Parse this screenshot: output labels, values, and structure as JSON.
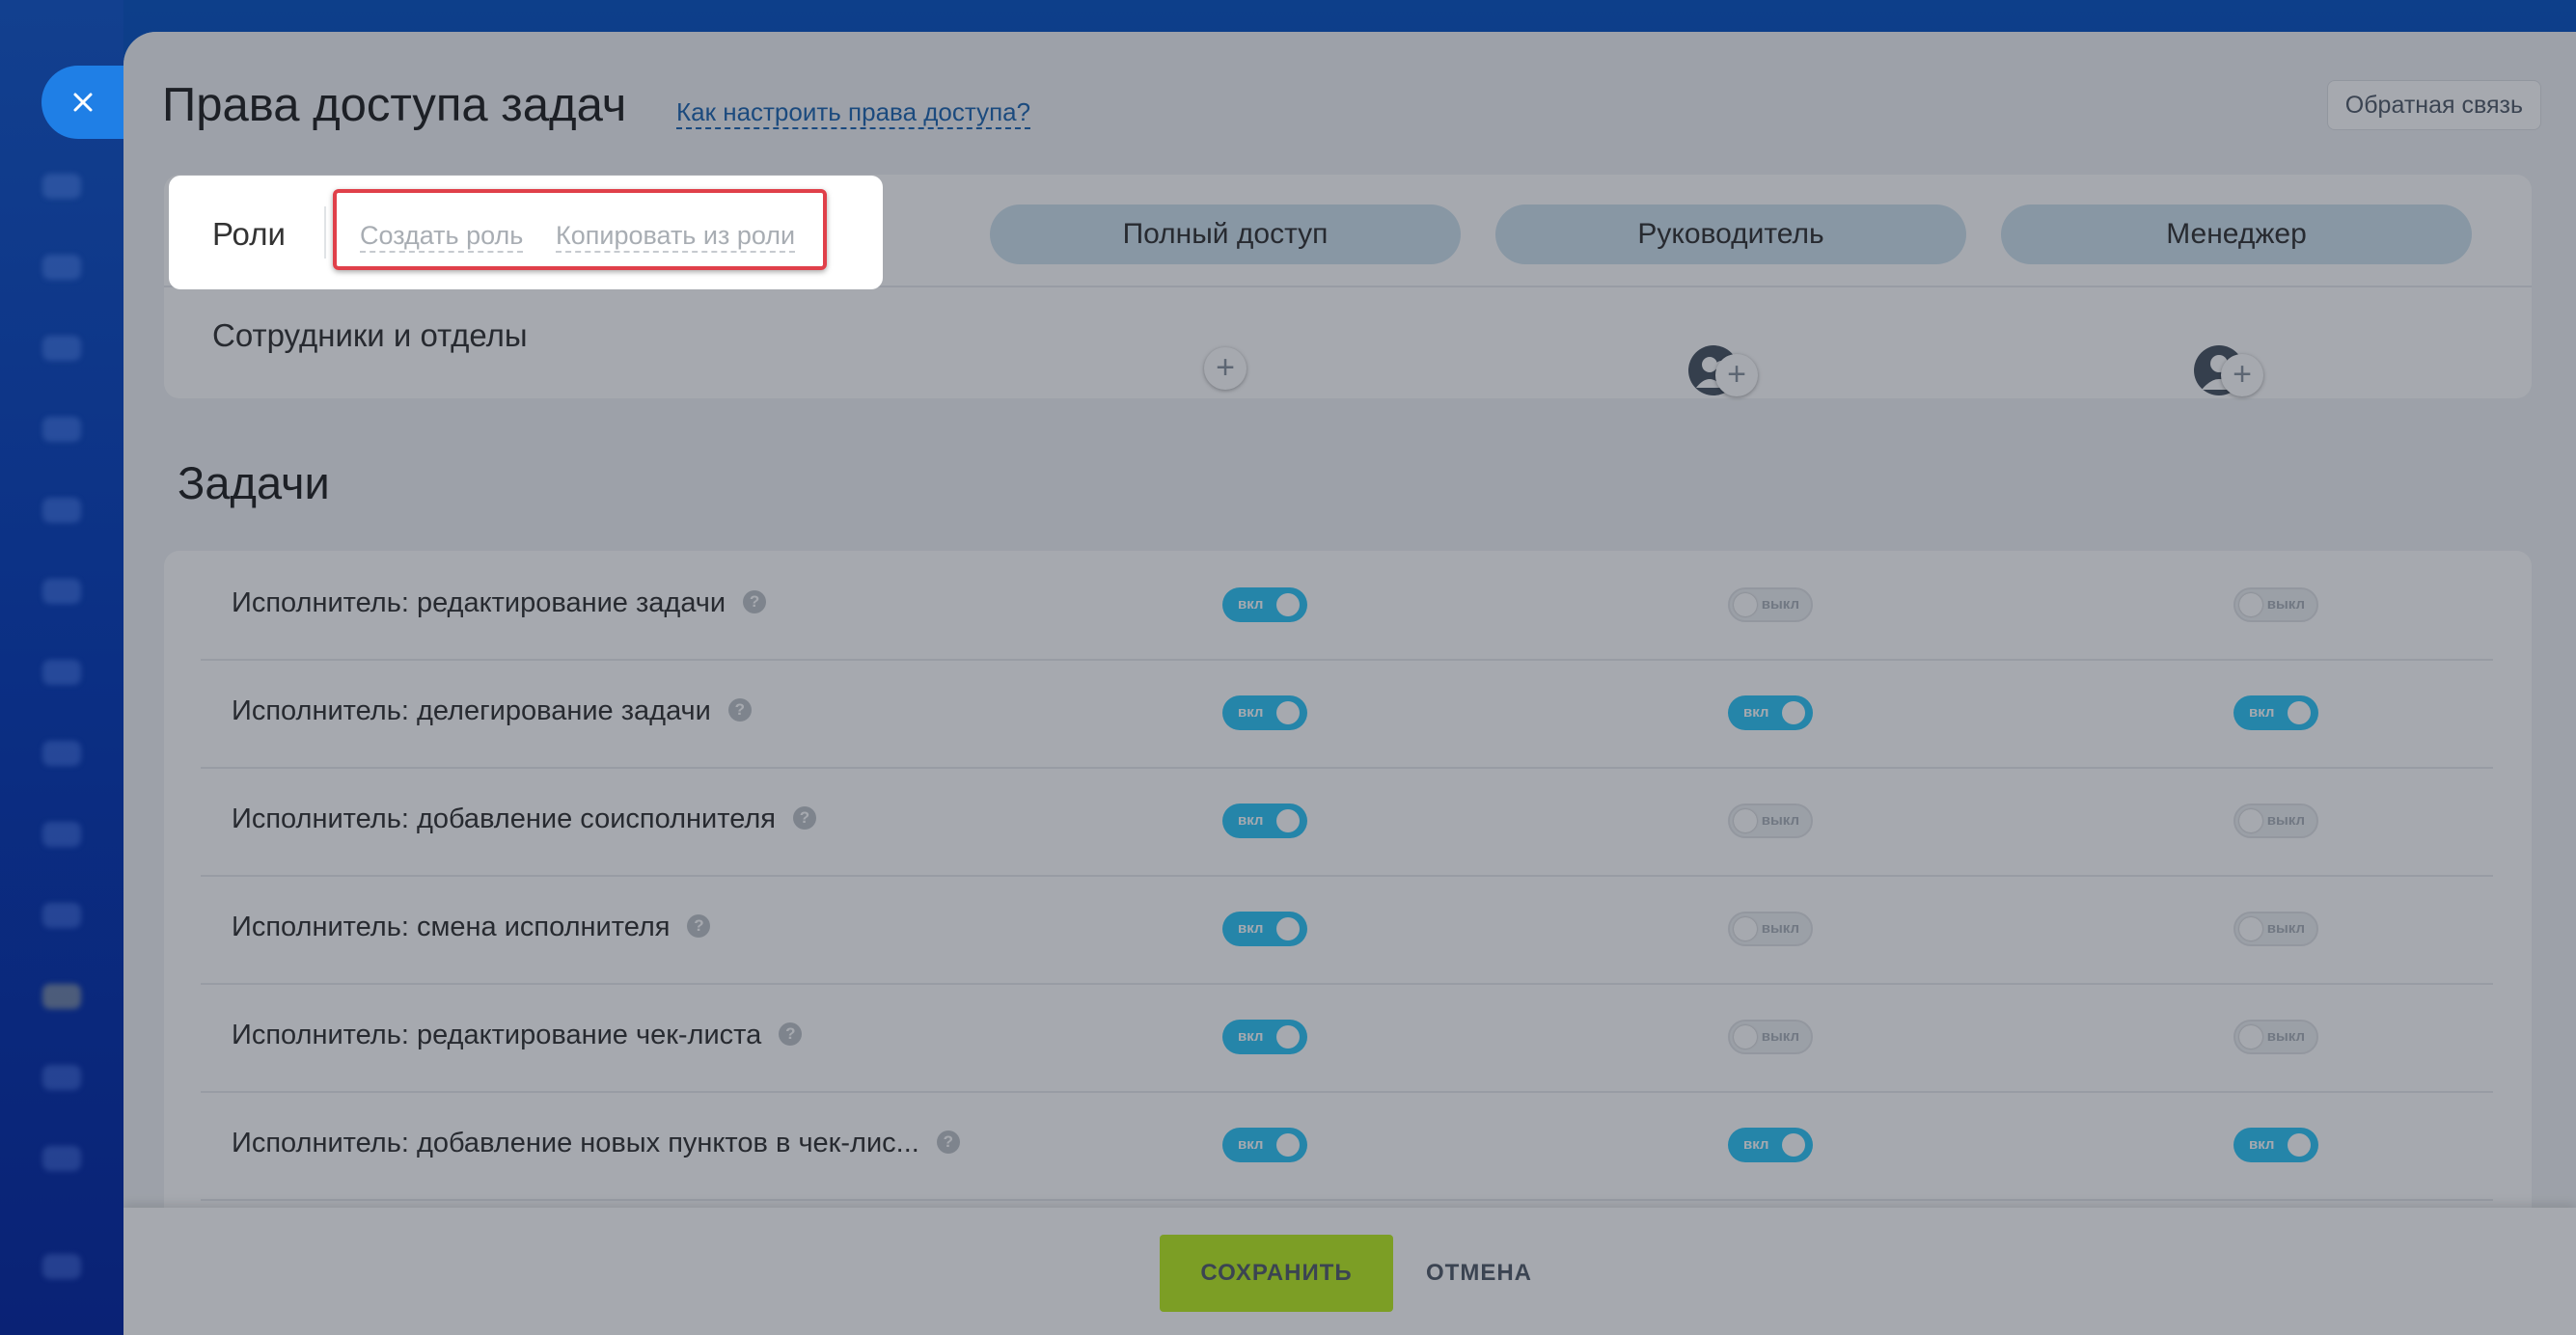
{
  "window": {
    "title": "Права доступа задач",
    "help_link": "Как настроить права доступа?",
    "feedback_button": "Обратная связь",
    "close_icon": "close-icon"
  },
  "roles_bar": {
    "label": "Роли",
    "create_role": "Создать роль",
    "copy_from_role": "Копировать из роли",
    "columns": [
      "Полный доступ",
      "Руководитель",
      "Менеджер"
    ],
    "employees_label": "Сотрудники и отделы"
  },
  "tasks": {
    "section_title": "Задачи",
    "rows": [
      {
        "label": "Исполнитель: редактирование задачи",
        "values": [
          "вкл",
          "выкл",
          "выкл"
        ]
      },
      {
        "label": "Исполнитель: делегирование задачи",
        "values": [
          "вкл",
          "вкл",
          "вкл"
        ]
      },
      {
        "label": "Исполнитель: добавление соисполнителя",
        "values": [
          "вкл",
          "выкл",
          "выкл"
        ]
      },
      {
        "label": "Исполнитель: смена исполнителя",
        "values": [
          "вкл",
          "выкл",
          "выкл"
        ]
      },
      {
        "label": "Исполнитель: редактирование чек-листа",
        "values": [
          "вкл",
          "выкл",
          "выкл"
        ]
      },
      {
        "label": "Исполнитель: добавление новых пунктов в чек-лис...",
        "values": [
          "вкл",
          "вкл",
          "вкл"
        ]
      }
    ],
    "on_label": "вкл",
    "off_label": "выкл",
    "question_mark": "?"
  },
  "footer": {
    "save": "СОХРАНИТЬ",
    "cancel": "ОТМЕНА"
  },
  "colors": {
    "toggle_on": "#2fc6f6",
    "save_button": "#bbed21",
    "highlight_frame": "#e0404a",
    "role_pill": "#cfe2ee"
  }
}
